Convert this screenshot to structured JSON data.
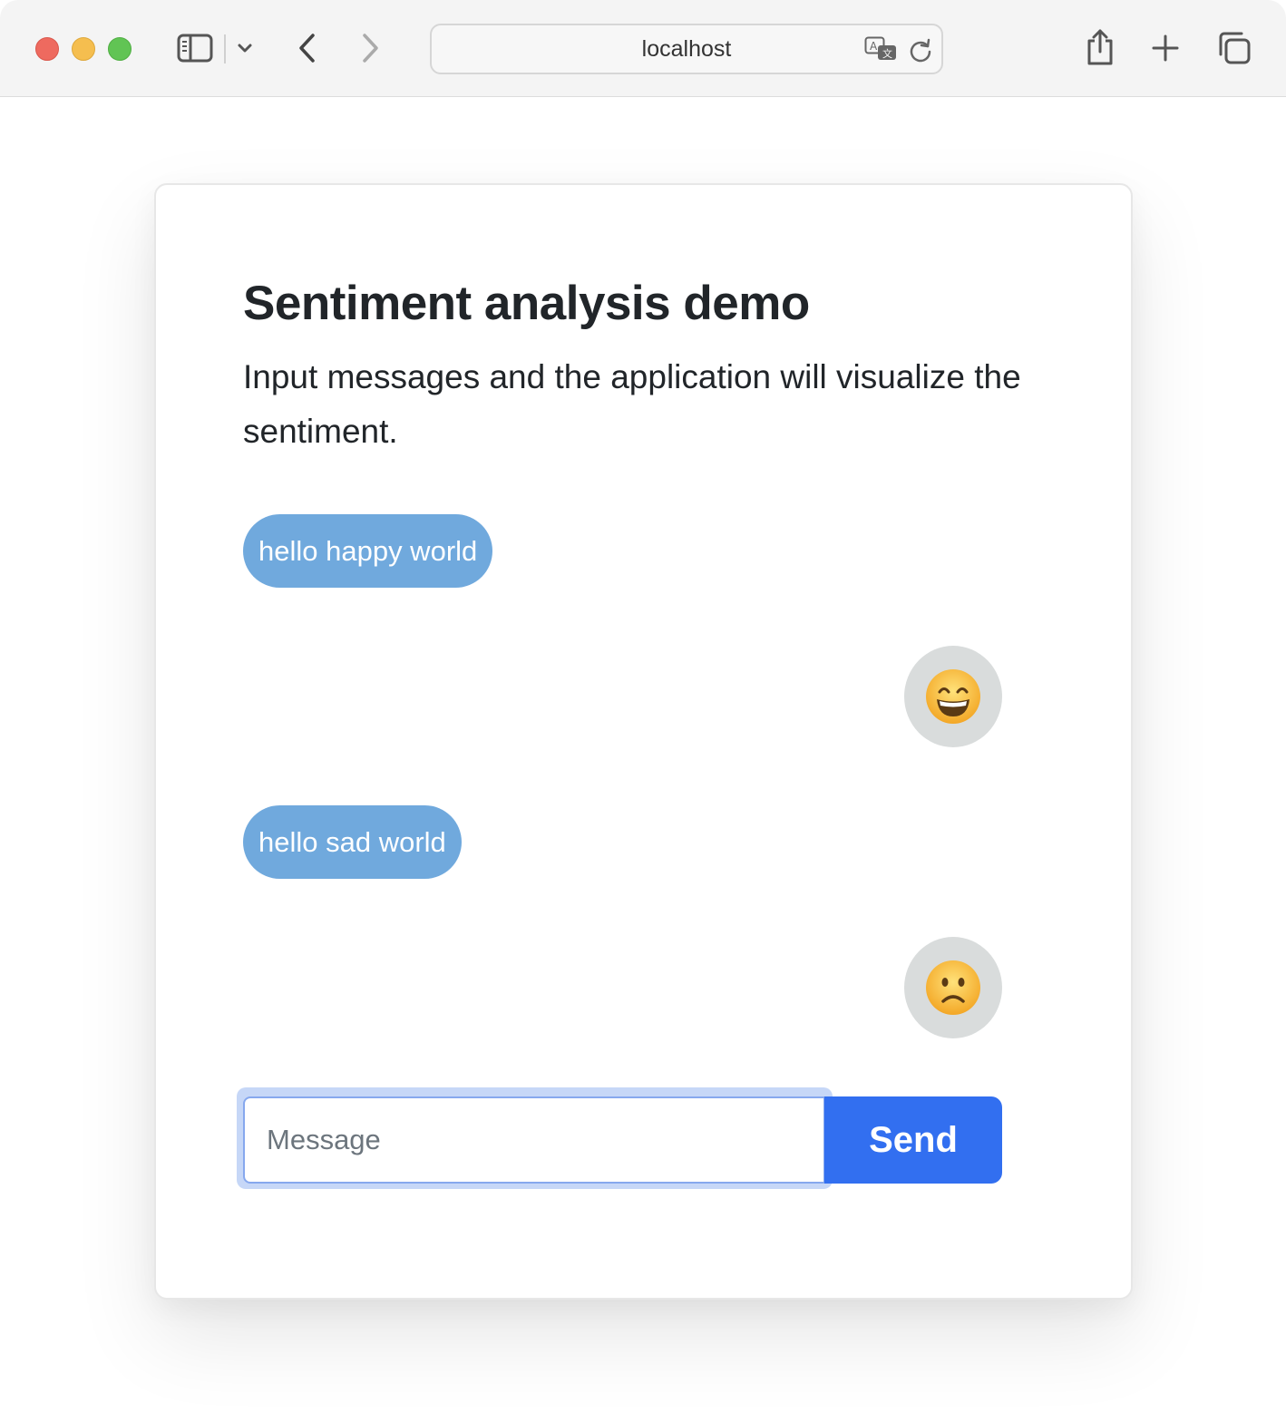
{
  "browser": {
    "url": "localhost",
    "icons": {
      "sidebar": "sidebar-icon",
      "sidebar_menu": "chevron-down-icon",
      "back": "chevron-left-icon",
      "forward": "chevron-right-icon",
      "translate": "translate-icon",
      "reload": "reload-icon",
      "share": "share-icon",
      "new_tab": "plus-icon",
      "tabs": "tab-overview-icon"
    }
  },
  "app": {
    "title": "Sentiment analysis demo",
    "subtitle": "Input messages and the application will visualize the sentiment.",
    "messages": [
      {
        "text": "hello happy world",
        "sentiment": "happy",
        "reaction_icon": "grinning-face-icon"
      },
      {
        "text": "hello sad world",
        "sentiment": "sad",
        "reaction_icon": "frowning-face-icon"
      }
    ],
    "input": {
      "placeholder": "Message",
      "value": ""
    },
    "send_label": "Send"
  },
  "colors": {
    "bubble": "#70a9dd",
    "reaction_bg": "#d9dcdc",
    "send_button": "#326ff0",
    "input_focus": "#86a8ee",
    "text": "#212529"
  }
}
